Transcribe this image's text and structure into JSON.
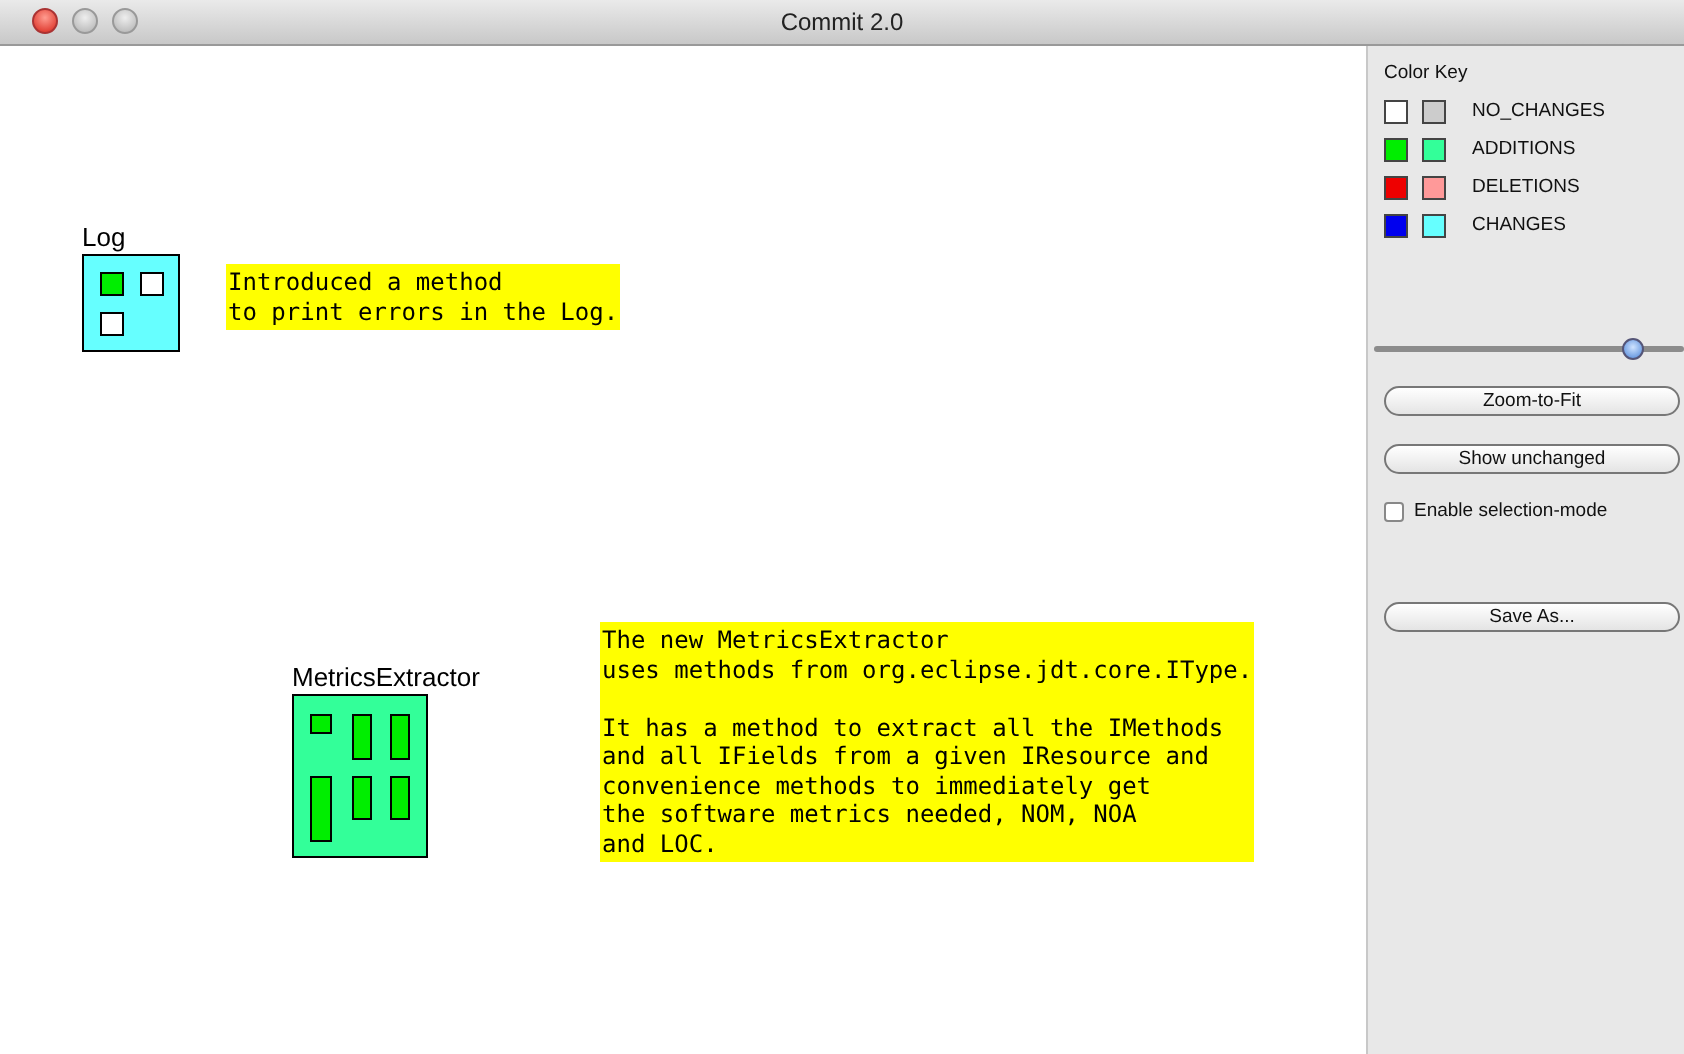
{
  "window": {
    "title": "Commit 2.0"
  },
  "classes": [
    {
      "name": "Log",
      "color": "#66ffff",
      "members": [
        {
          "color": "#00ee00"
        },
        {
          "color": "#ffffff"
        },
        {
          "color": "#ffffff"
        }
      ]
    },
    {
      "name": "MetricsExtractor",
      "color": "#33ff99",
      "members": [
        {
          "color": "#00ee00"
        },
        {
          "color": "#00ee00"
        },
        {
          "color": "#00ee00"
        },
        {
          "color": "#00ee00"
        },
        {
          "color": "#00ee00"
        },
        {
          "color": "#00ee00"
        }
      ]
    }
  ],
  "notes": [
    {
      "paragraphs": [
        [
          "Introduced a method",
          "to print errors in the Log."
        ]
      ]
    },
    {
      "paragraphs": [
        [
          "The new MetricsExtractor",
          "uses methods from org.eclipse.jdt.core.IType."
        ],
        [
          "It has a method to extract all the IMethods",
          "and all IFields from a given IResource and",
          "convenience methods to immediately get",
          "the software metrics needed, NOM, NOA",
          "and LOC."
        ]
      ]
    }
  ],
  "sidebar": {
    "legend_title": "Color Key",
    "legend": [
      {
        "label": "NO_CHANGES",
        "swatches": [
          {
            "color": "#ffffff"
          },
          {
            "color": "#cccccc"
          }
        ]
      },
      {
        "label": "ADDITIONS",
        "swatches": [
          {
            "color": "#00ee00"
          },
          {
            "color": "#33ff99"
          }
        ]
      },
      {
        "label": "DELETIONS",
        "swatches": [
          {
            "color": "#ee0000"
          },
          {
            "color": "#ff9999"
          }
        ]
      },
      {
        "label": "CHANGES",
        "swatches": [
          {
            "color": "#0000ee"
          },
          {
            "color": "#66ffff"
          }
        ]
      }
    ],
    "zoom_slider": {
      "level": 0.84
    },
    "buttons": [
      "Zoom-to-Fit",
      "Show unchanged"
    ],
    "selection_mode": {
      "label": "Enable selection-mode",
      "checked": false
    },
    "save_button": "Save As..."
  }
}
